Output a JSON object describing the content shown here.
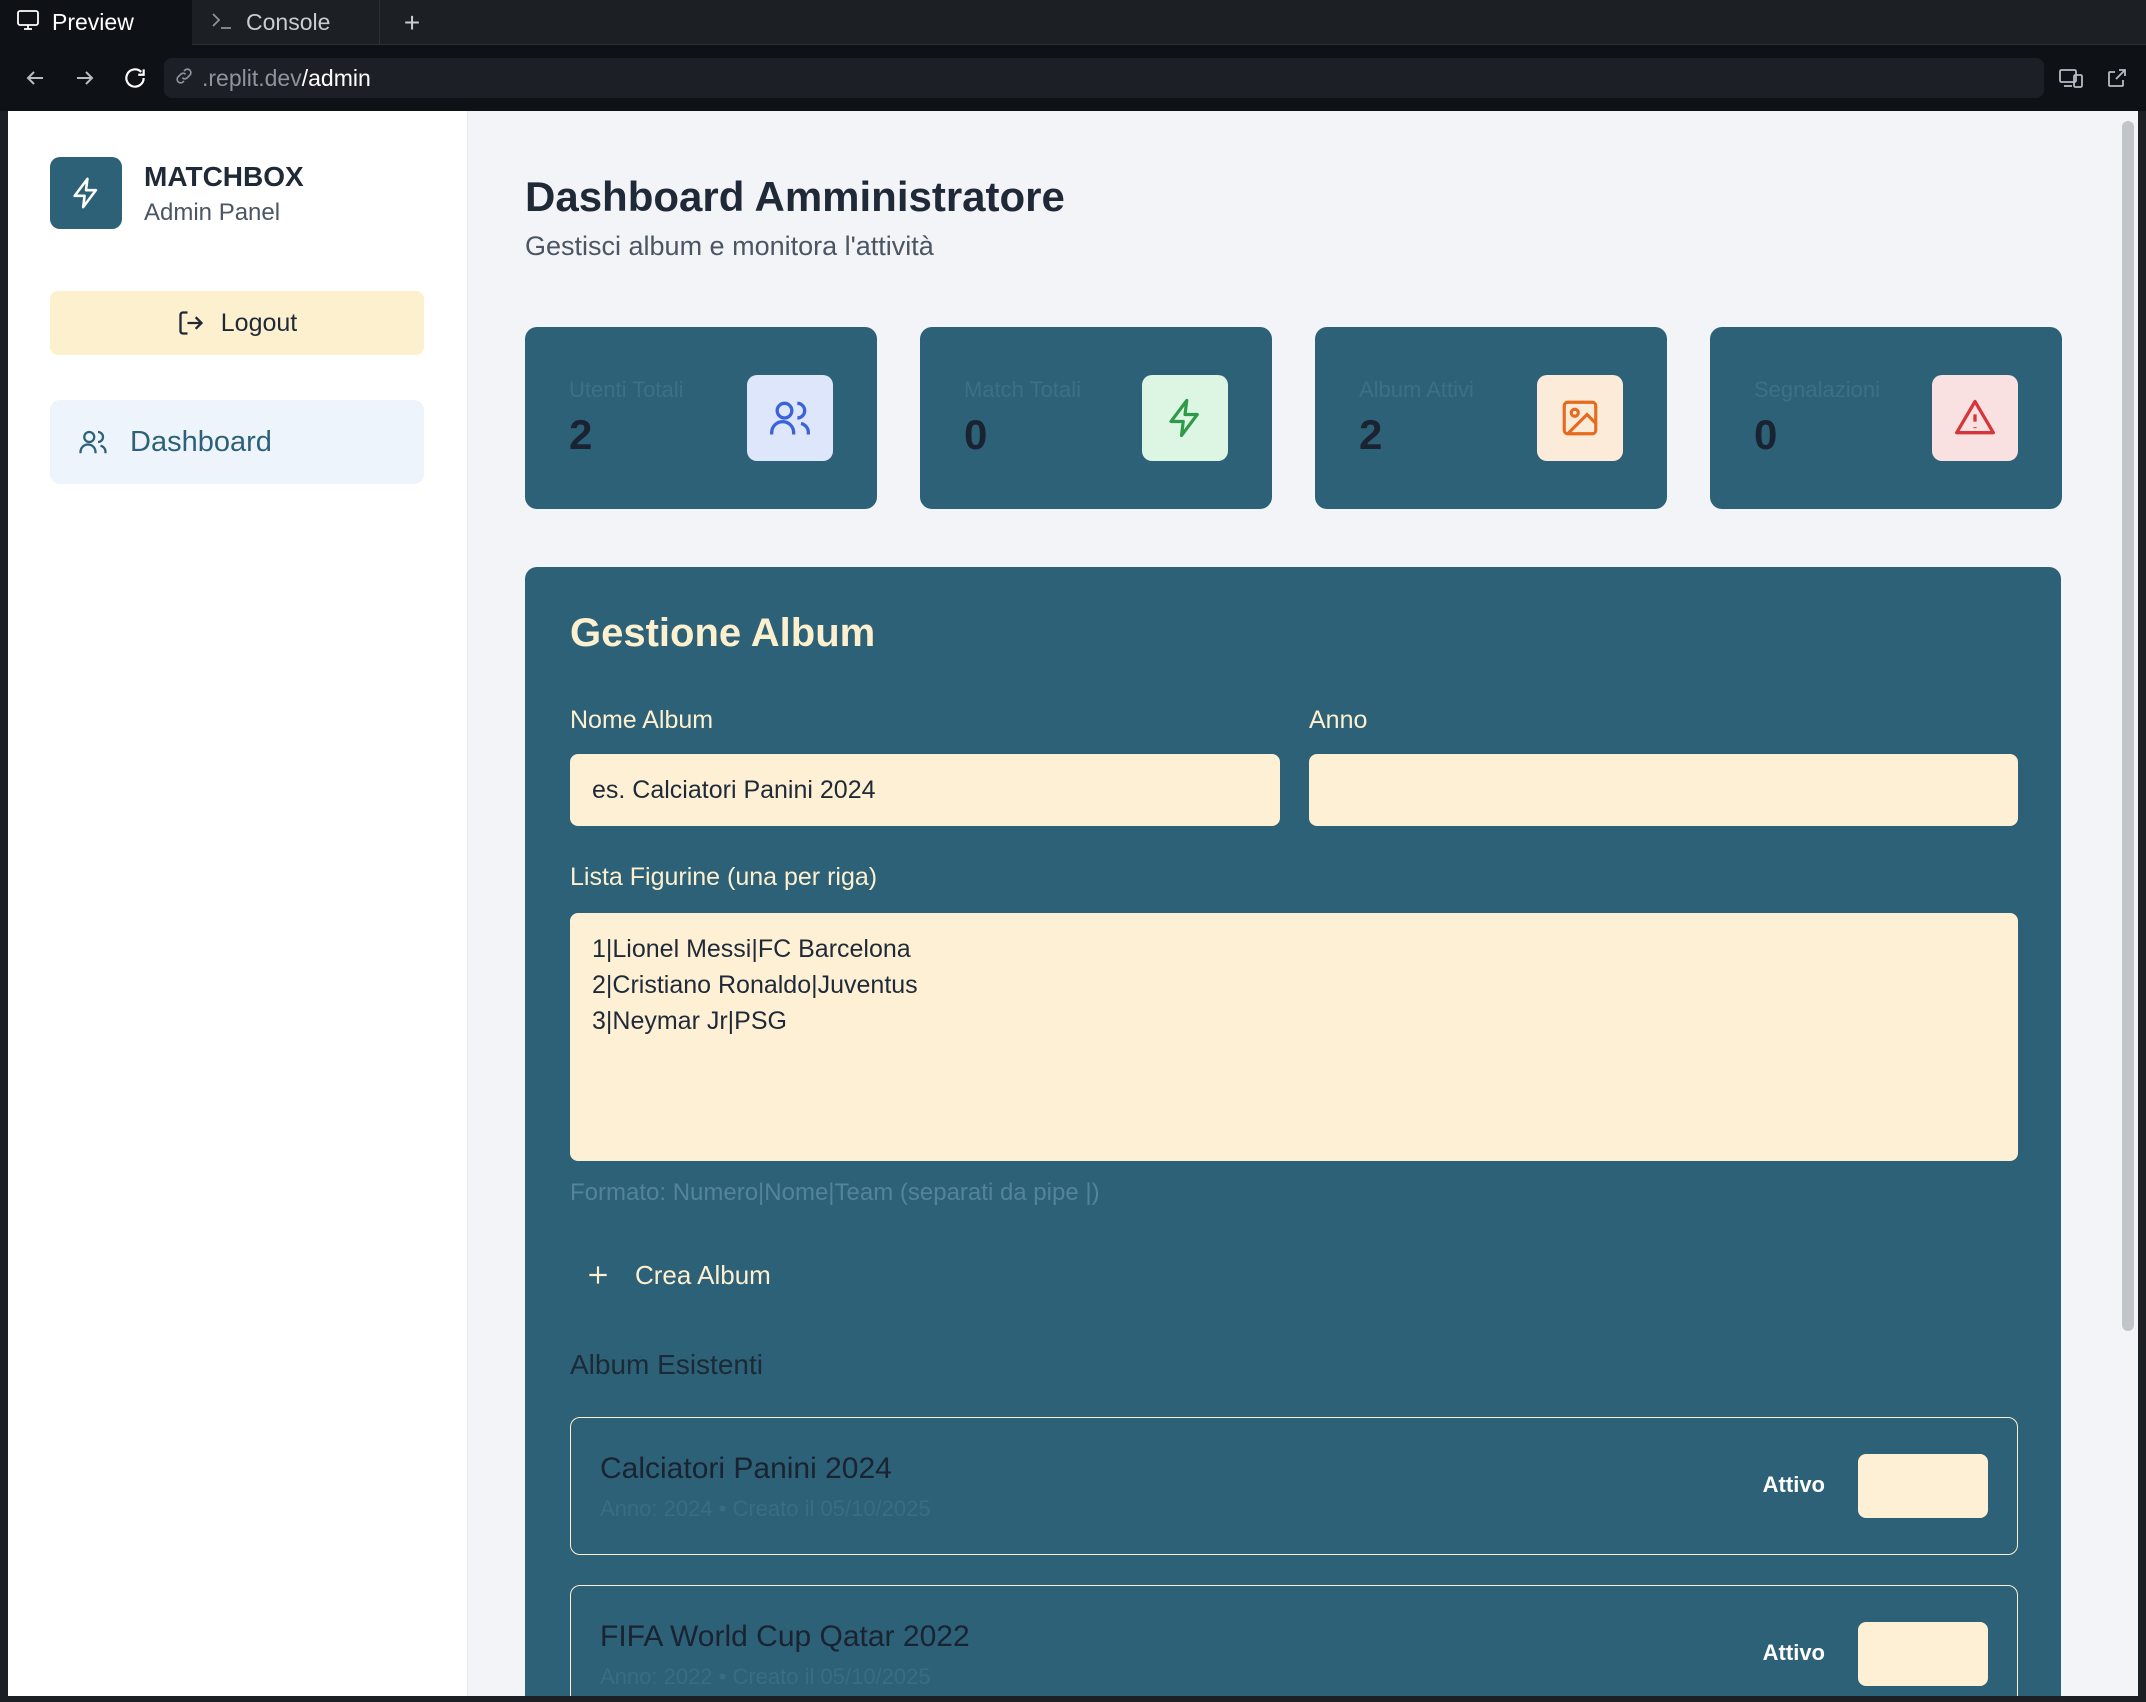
{
  "browser": {
    "tabs": [
      {
        "label": "Preview",
        "active": true
      },
      {
        "label": "Console",
        "active": false
      }
    ],
    "url_host": ".replit.dev",
    "url_path": "/admin"
  },
  "sidebar": {
    "brand": "MATCHBOX",
    "brand_sub": "Admin Panel",
    "logout_label": "Logout",
    "nav": [
      {
        "label": "Dashboard",
        "icon": "users-icon",
        "active": true
      }
    ]
  },
  "header": {
    "title": "Dashboard Amministratore",
    "subtitle": "Gestisci album e monitora l'attività"
  },
  "stats": [
    {
      "label": "Utenti Totali",
      "value": "2",
      "icon": "users-icon",
      "icon_bg": "#dde6fb",
      "icon_color": "#3b63d9"
    },
    {
      "label": "Match Totali",
      "value": "0",
      "icon": "zap-icon",
      "icon_bg": "#ddf5e3",
      "icon_color": "#2f9a4a"
    },
    {
      "label": "Album Attivi",
      "value": "2",
      "icon": "image-icon",
      "icon_bg": "#fcebd9",
      "icon_color": "#e56b1f"
    },
    {
      "label": "Segnalazioni",
      "value": "0",
      "icon": "alert-triangle-icon",
      "icon_bg": "#f9e1e1",
      "icon_color": "#d4363b"
    }
  ],
  "album_form": {
    "title": "Gestione Album",
    "name_label": "Nome Album",
    "name_placeholder": "es. Calciatori Panini 2024",
    "year_label": "Anno",
    "year_value": "",
    "list_label": "Lista Figurine (una per riga)",
    "list_lines": [
      "1|Lionel Messi|FC Barcelona",
      "2|Cristiano Ronaldo|Juventus",
      "3|Neymar Jr|PSG"
    ],
    "hint": "Formato: Numero|Nome|Team (separati da pipe |)",
    "create_label": "Crea Album"
  },
  "existing": {
    "title": "Album Esistenti",
    "albums": [
      {
        "name": "Calciatori Panini 2024",
        "meta": "Anno: 2024 • Creato il 05/10/2025",
        "status": "Attivo"
      },
      {
        "name": "FIFA World Cup Qatar 2022",
        "meta": "Anno: 2022 • Creato il 05/10/2025",
        "status": "Attivo"
      }
    ]
  },
  "colors": {
    "primary": "#2d6177",
    "cream": "#fdf0cf"
  }
}
